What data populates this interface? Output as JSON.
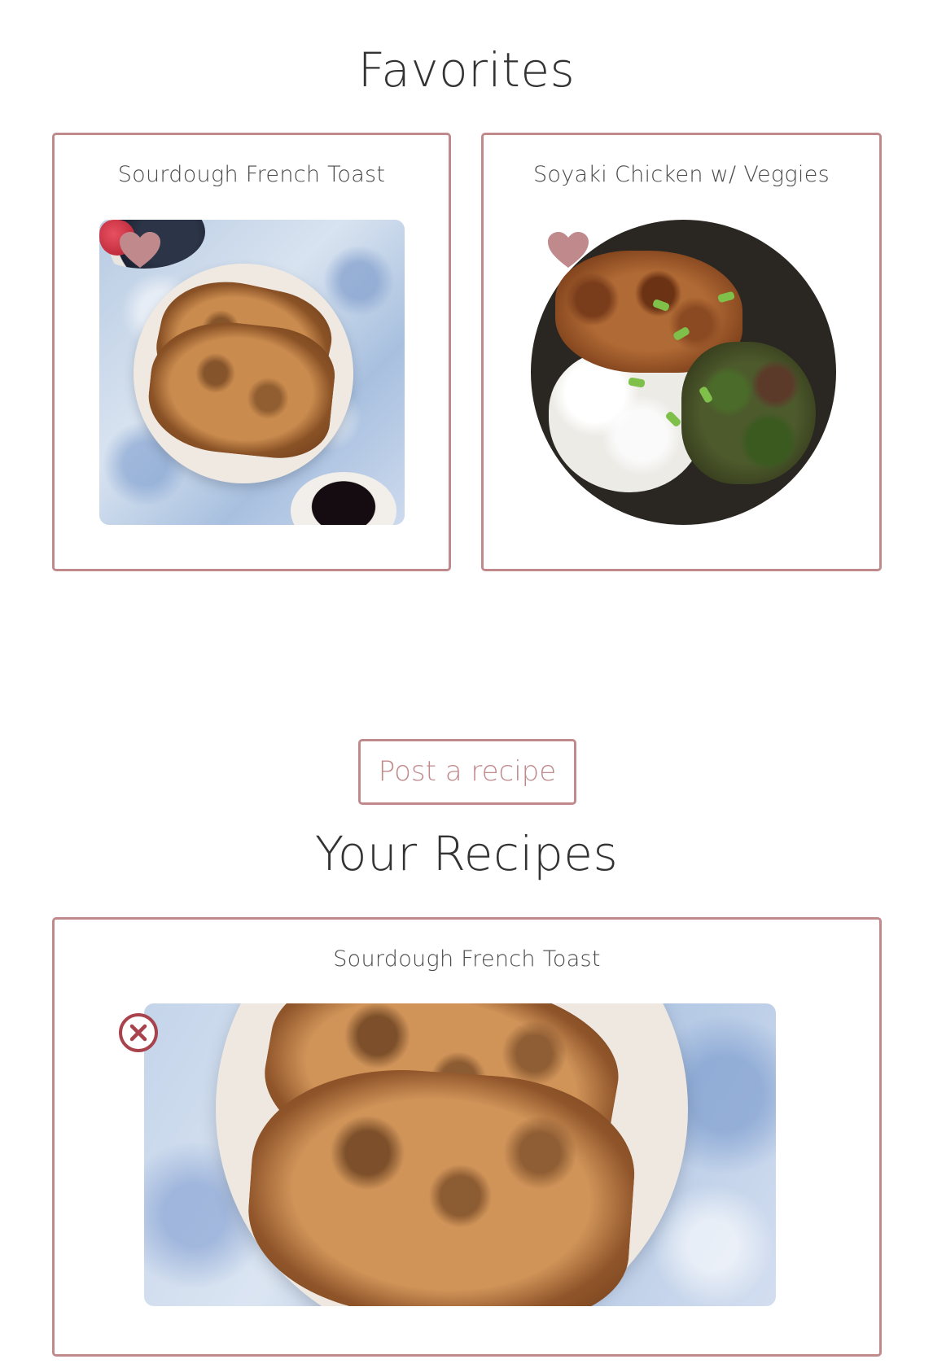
{
  "favorites": {
    "title": "Favorites",
    "cards": [
      {
        "title": "Sourdough French Toast",
        "icon": "heart-icon"
      },
      {
        "title": "Soyaki Chicken w/ Veggies",
        "icon": "heart-icon"
      }
    ]
  },
  "post_button": {
    "label": "Post a recipe"
  },
  "your_recipes": {
    "title": "Your Recipes",
    "cards": [
      {
        "title": "Sourdough French Toast",
        "icon": "delete-icon"
      }
    ]
  },
  "colors": {
    "accent": "#c08a8d",
    "delete": "#a8424c",
    "text": "#333333"
  }
}
